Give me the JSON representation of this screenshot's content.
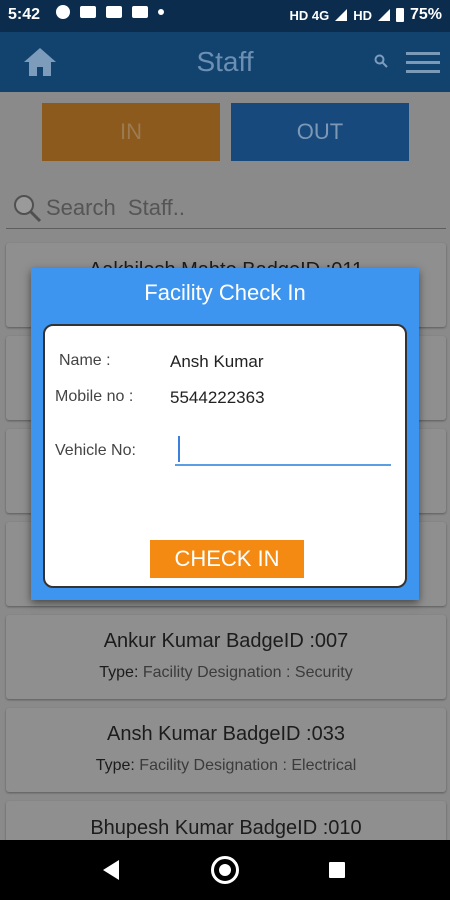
{
  "status_bar": {
    "time": "5:42",
    "network": "HD 4G",
    "network2": "HD",
    "battery": "75%"
  },
  "app_bar": {
    "title": "Staff"
  },
  "tabs": {
    "in_label": "IN",
    "out_label": "OUT"
  },
  "search": {
    "placeholder": "Search  Staff.."
  },
  "list": {
    "items": [
      {
        "name": "Aakhilesh  Mahto  BadgeID :011"
      },
      {
        "name": "Ankur  Kumar  BadgeID :007",
        "type_label": "Type:",
        "type_value": " Facility Designation : Security"
      },
      {
        "name": "Ansh   Kumar  BadgeID :033",
        "type_label": "Type:",
        "type_value": " Facility Designation : Electrical"
      },
      {
        "name": "Bhupesh  Kumar  BadgeID :010"
      }
    ]
  },
  "dialog": {
    "title": "Facility Check In",
    "name_label": "Name :",
    "name_value": "Ansh   Kumar",
    "mobile_label": "Mobile no :",
    "mobile_value": "5544222363",
    "vehicle_label": "Vehicle No:",
    "vehicle_value": "",
    "button_label": "CHECK IN"
  },
  "colors": {
    "accent_blue": "#3d95f0",
    "button_orange": "#f58a12",
    "app_bar": "#12436f"
  }
}
